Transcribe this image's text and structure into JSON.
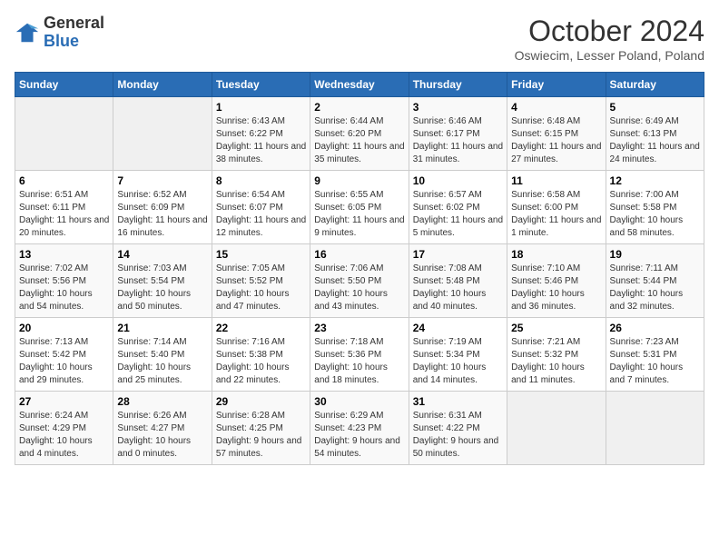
{
  "header": {
    "logo": {
      "general": "General",
      "blue": "Blue"
    },
    "month_title": "October 2024",
    "subtitle": "Oswiecim, Lesser Poland, Poland"
  },
  "days_of_week": [
    "Sunday",
    "Monday",
    "Tuesday",
    "Wednesday",
    "Thursday",
    "Friday",
    "Saturday"
  ],
  "weeks": [
    [
      {
        "day": null
      },
      {
        "day": null
      },
      {
        "day": 1,
        "sunrise": "Sunrise: 6:43 AM",
        "sunset": "Sunset: 6:22 PM",
        "daylight": "Daylight: 11 hours and 38 minutes."
      },
      {
        "day": 2,
        "sunrise": "Sunrise: 6:44 AM",
        "sunset": "Sunset: 6:20 PM",
        "daylight": "Daylight: 11 hours and 35 minutes."
      },
      {
        "day": 3,
        "sunrise": "Sunrise: 6:46 AM",
        "sunset": "Sunset: 6:17 PM",
        "daylight": "Daylight: 11 hours and 31 minutes."
      },
      {
        "day": 4,
        "sunrise": "Sunrise: 6:48 AM",
        "sunset": "Sunset: 6:15 PM",
        "daylight": "Daylight: 11 hours and 27 minutes."
      },
      {
        "day": 5,
        "sunrise": "Sunrise: 6:49 AM",
        "sunset": "Sunset: 6:13 PM",
        "daylight": "Daylight: 11 hours and 24 minutes."
      }
    ],
    [
      {
        "day": 6,
        "sunrise": "Sunrise: 6:51 AM",
        "sunset": "Sunset: 6:11 PM",
        "daylight": "Daylight: 11 hours and 20 minutes."
      },
      {
        "day": 7,
        "sunrise": "Sunrise: 6:52 AM",
        "sunset": "Sunset: 6:09 PM",
        "daylight": "Daylight: 11 hours and 16 minutes."
      },
      {
        "day": 8,
        "sunrise": "Sunrise: 6:54 AM",
        "sunset": "Sunset: 6:07 PM",
        "daylight": "Daylight: 11 hours and 12 minutes."
      },
      {
        "day": 9,
        "sunrise": "Sunrise: 6:55 AM",
        "sunset": "Sunset: 6:05 PM",
        "daylight": "Daylight: 11 hours and 9 minutes."
      },
      {
        "day": 10,
        "sunrise": "Sunrise: 6:57 AM",
        "sunset": "Sunset: 6:02 PM",
        "daylight": "Daylight: 11 hours and 5 minutes."
      },
      {
        "day": 11,
        "sunrise": "Sunrise: 6:58 AM",
        "sunset": "Sunset: 6:00 PM",
        "daylight": "Daylight: 11 hours and 1 minute."
      },
      {
        "day": 12,
        "sunrise": "Sunrise: 7:00 AM",
        "sunset": "Sunset: 5:58 PM",
        "daylight": "Daylight: 10 hours and 58 minutes."
      }
    ],
    [
      {
        "day": 13,
        "sunrise": "Sunrise: 7:02 AM",
        "sunset": "Sunset: 5:56 PM",
        "daylight": "Daylight: 10 hours and 54 minutes."
      },
      {
        "day": 14,
        "sunrise": "Sunrise: 7:03 AM",
        "sunset": "Sunset: 5:54 PM",
        "daylight": "Daylight: 10 hours and 50 minutes."
      },
      {
        "day": 15,
        "sunrise": "Sunrise: 7:05 AM",
        "sunset": "Sunset: 5:52 PM",
        "daylight": "Daylight: 10 hours and 47 minutes."
      },
      {
        "day": 16,
        "sunrise": "Sunrise: 7:06 AM",
        "sunset": "Sunset: 5:50 PM",
        "daylight": "Daylight: 10 hours and 43 minutes."
      },
      {
        "day": 17,
        "sunrise": "Sunrise: 7:08 AM",
        "sunset": "Sunset: 5:48 PM",
        "daylight": "Daylight: 10 hours and 40 minutes."
      },
      {
        "day": 18,
        "sunrise": "Sunrise: 7:10 AM",
        "sunset": "Sunset: 5:46 PM",
        "daylight": "Daylight: 10 hours and 36 minutes."
      },
      {
        "day": 19,
        "sunrise": "Sunrise: 7:11 AM",
        "sunset": "Sunset: 5:44 PM",
        "daylight": "Daylight: 10 hours and 32 minutes."
      }
    ],
    [
      {
        "day": 20,
        "sunrise": "Sunrise: 7:13 AM",
        "sunset": "Sunset: 5:42 PM",
        "daylight": "Daylight: 10 hours and 29 minutes."
      },
      {
        "day": 21,
        "sunrise": "Sunrise: 7:14 AM",
        "sunset": "Sunset: 5:40 PM",
        "daylight": "Daylight: 10 hours and 25 minutes."
      },
      {
        "day": 22,
        "sunrise": "Sunrise: 7:16 AM",
        "sunset": "Sunset: 5:38 PM",
        "daylight": "Daylight: 10 hours and 22 minutes."
      },
      {
        "day": 23,
        "sunrise": "Sunrise: 7:18 AM",
        "sunset": "Sunset: 5:36 PM",
        "daylight": "Daylight: 10 hours and 18 minutes."
      },
      {
        "day": 24,
        "sunrise": "Sunrise: 7:19 AM",
        "sunset": "Sunset: 5:34 PM",
        "daylight": "Daylight: 10 hours and 14 minutes."
      },
      {
        "day": 25,
        "sunrise": "Sunrise: 7:21 AM",
        "sunset": "Sunset: 5:32 PM",
        "daylight": "Daylight: 10 hours and 11 minutes."
      },
      {
        "day": 26,
        "sunrise": "Sunrise: 7:23 AM",
        "sunset": "Sunset: 5:31 PM",
        "daylight": "Daylight: 10 hours and 7 minutes."
      }
    ],
    [
      {
        "day": 27,
        "sunrise": "Sunrise: 6:24 AM",
        "sunset": "Sunset: 4:29 PM",
        "daylight": "Daylight: 10 hours and 4 minutes."
      },
      {
        "day": 28,
        "sunrise": "Sunrise: 6:26 AM",
        "sunset": "Sunset: 4:27 PM",
        "daylight": "Daylight: 10 hours and 0 minutes."
      },
      {
        "day": 29,
        "sunrise": "Sunrise: 6:28 AM",
        "sunset": "Sunset: 4:25 PM",
        "daylight": "Daylight: 9 hours and 57 minutes."
      },
      {
        "day": 30,
        "sunrise": "Sunrise: 6:29 AM",
        "sunset": "Sunset: 4:23 PM",
        "daylight": "Daylight: 9 hours and 54 minutes."
      },
      {
        "day": 31,
        "sunrise": "Sunrise: 6:31 AM",
        "sunset": "Sunset: 4:22 PM",
        "daylight": "Daylight: 9 hours and 50 minutes."
      },
      {
        "day": null
      },
      {
        "day": null
      }
    ]
  ]
}
